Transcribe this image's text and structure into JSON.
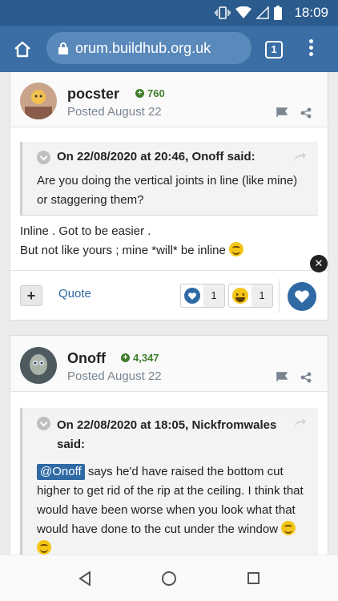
{
  "status": {
    "time": "18:09"
  },
  "browser": {
    "url": "orum.buildhub.org.uk",
    "tab_count": "1"
  },
  "posts": [
    {
      "author": "pocster",
      "reputation": "760",
      "posted": "Posted August 22",
      "quote_header": "On 22/08/2020 at 20:46, Onoff said:",
      "quote_body": "Are you doing the vertical joints in line (like mine) or staggering them?",
      "body_line1": "Inline . Got to be easier .",
      "body_line2": "But not like yours ; mine *will* be inline",
      "quote_label": "Quote",
      "reactions": [
        {
          "name": "like",
          "count": "1"
        },
        {
          "name": "haha",
          "count": "1"
        }
      ]
    },
    {
      "author": "Onoff",
      "reputation": "4,347",
      "posted": "Posted August 22",
      "quote_header": "On 22/08/2020 at 18:05, Nickfromwales said:",
      "mention": "@Onoff",
      "quote_body": " says he'd have raised the bottom cut higher to get rid of the rip at the ceiling. I think that would have been worse when you look what that would have done to the cut under the window "
    }
  ],
  "colors": {
    "status_bar": "#2b5a8d",
    "url_bar": "#3a6ea5",
    "accent": "#2f6aa5",
    "reputation": "#3f7d2c"
  }
}
